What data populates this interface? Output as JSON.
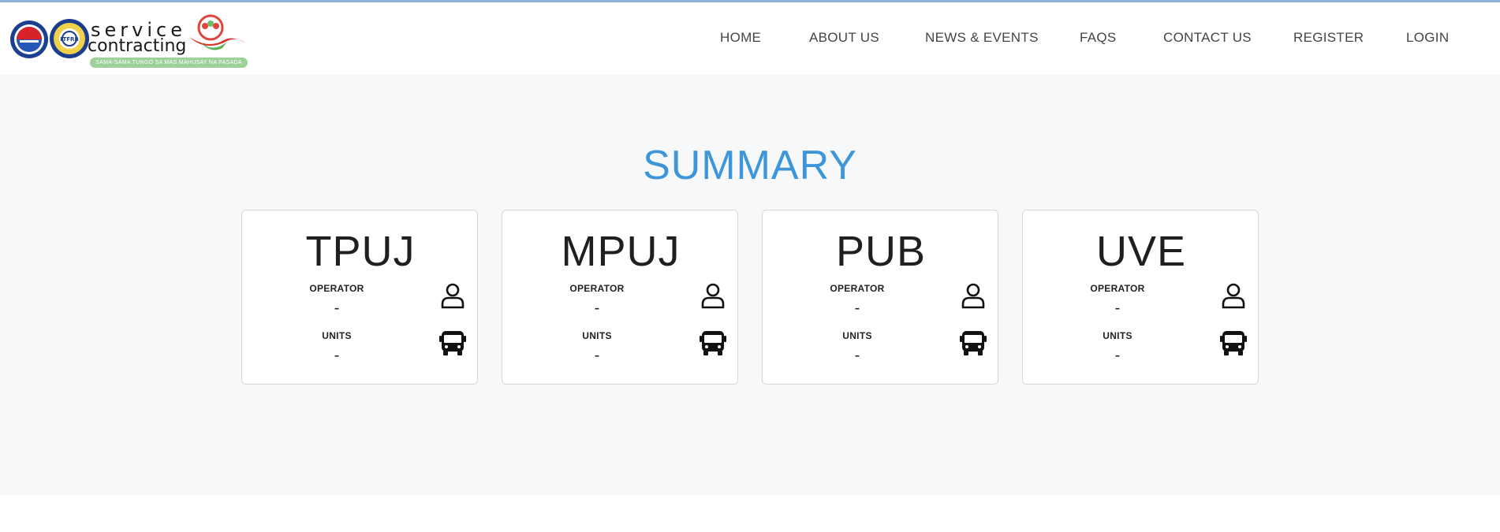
{
  "header": {
    "logo": {
      "line1": "service",
      "line2": "contracting",
      "tagline": "SAMA-SAMA TUNGO SA MAS MAHUSAY NA PASADA",
      "seal_text": "LTFRB"
    },
    "nav": [
      {
        "label": "HOME",
        "icon": null
      },
      {
        "label": "ABOUT US",
        "icon": null
      },
      {
        "label": "NEWS & EVENTS",
        "icon": null
      },
      {
        "label": "FAQS",
        "icon": null
      },
      {
        "label": "CONTACT US",
        "icon": null
      },
      {
        "label": "REGISTER",
        "icon": null
      },
      {
        "label": "LOGIN",
        "icon": null
      }
    ]
  },
  "main": {
    "title": "SUMMARY",
    "cards": [
      {
        "title": "TPUJ",
        "operator_label": "OPERATOR",
        "operator_value": "-",
        "units_label": "UNITS",
        "units_value": "-",
        "operator_icon": "user-icon",
        "units_icon": "bus-icon"
      },
      {
        "title": "MPUJ",
        "operator_label": "OPERATOR",
        "operator_value": "-",
        "units_label": "UNITS",
        "units_value": "-",
        "operator_icon": "user-icon",
        "units_icon": "bus-icon"
      },
      {
        "title": "PUB",
        "operator_label": "OPERATOR",
        "operator_value": "-",
        "units_label": "UNITS",
        "units_value": "-",
        "operator_icon": "user-icon",
        "units_icon": "bus-icon"
      },
      {
        "title": "UVE",
        "operator_label": "OPERATOR",
        "operator_value": "-",
        "units_label": "UNITS",
        "units_value": "-",
        "operator_icon": "user-icon",
        "units_icon": "bus-icon"
      }
    ]
  },
  "colors": {
    "accent": "#3d96d9",
    "background": "#f7f8fa",
    "card_border": "#d4d7dc",
    "tagline_bg": "#9dd19a"
  }
}
